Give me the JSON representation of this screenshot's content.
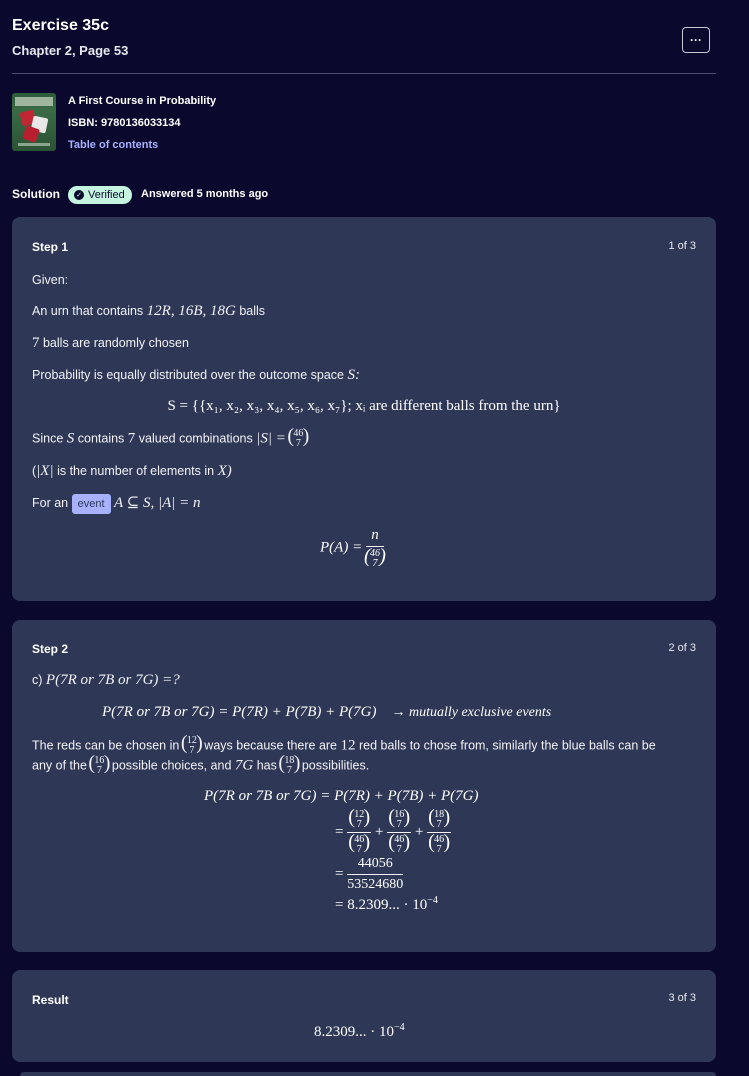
{
  "header": {
    "title": "Exercise 35c",
    "subtitle": "Chapter 2, Page 53",
    "more_label": "···"
  },
  "book": {
    "title": "A First Course in Probability",
    "isbn": "ISBN: 9780136033134",
    "toc_label": "Table of contents"
  },
  "solution": {
    "label": "Solution",
    "verified_label": "Verified",
    "answered": "Answered 5 months ago"
  },
  "steps": [
    {
      "title": "Step 1",
      "count": "1 of 3",
      "given": "Given:",
      "urn_text": "An urn that contains",
      "urn_math": "12R, 16B, 18G",
      "urn_suffix": "balls",
      "chosen_math": "7",
      "chosen_text": "balls are randomly chosen",
      "prob_text": "Probability is equally distributed over the outcome space",
      "prob_math": "S:",
      "set_def": "S = {{x₁, x₂, x₃, x₄, x₅, x₆, x₇}; xᵢ are different balls from the urn}",
      "since_text_1": "Since",
      "since_math_1": "S",
      "since_text_2": "contains",
      "since_math_2": "7",
      "since_text_3": "valued combinations",
      "since_math_3": "|S| =",
      "binom_top": "46",
      "binom_bottom": "7",
      "note_open": "(",
      "note_math": "|X|",
      "note_text": "is the number of elements in",
      "note_math_2": "X)",
      "event_prefix": "For an",
      "event_chip": "event",
      "event_math": "A ⊆ S,   |A| = n",
      "prob_formula_lhs": "P(A) =",
      "prob_formula_num": "n"
    },
    {
      "title": "Step 2",
      "count": "2 of 3",
      "question_prefix": "c)",
      "question_math": "P(7R or 7B or 7G) =?",
      "identity": "P(7R or 7B or 7G) = P(7R) + P(7B) + P(7G)",
      "identity_note": "→ mutually exclusive events",
      "explain_1": "The reds can be chosen in",
      "explain_2": "ways because there are",
      "explain_num": "12",
      "explain_3": "red balls to chose from, similarly the blue balls can be",
      "explain_4": "any of the",
      "explain_5": "possible choices, and",
      "explain_math": "7G",
      "explain_6": "has",
      "explain_7": "possibilities.",
      "calc_line_1": "P(7R or 7B or 7G) = P(7R) + P(7B) + P(7G)",
      "calc_num_a": "12",
      "calc_num_b": "16",
      "calc_num_c": "18",
      "calc_den": "46",
      "calc_k": "7",
      "calc_frac_num": "44056",
      "calc_frac_den": "53524680",
      "calc_result": "= 8.2309... · 10",
      "calc_exp": "−4"
    },
    {
      "title": "Result",
      "count": "3 of 3",
      "result": "8.2309... · 10",
      "result_exp": "−4"
    }
  ],
  "colors": {
    "background": "#0a092d",
    "card": "#2e3856",
    "accent": "#a8b1ff",
    "verified": "#c5f4e1"
  }
}
